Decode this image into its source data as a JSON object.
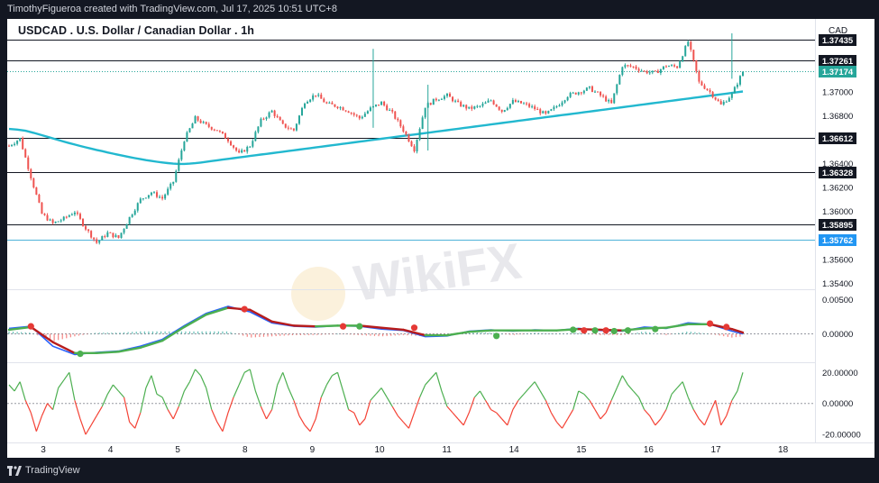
{
  "header": {
    "attribution": "TimothyFigueroa created with TradingView.com, Jul 17, 2025 10:51 UTC+8"
  },
  "chart": {
    "title": "USDCAD . U.S. Dollar / Canadian Dollar . 1h",
    "currency": "CAD",
    "watermark": "WikiFX"
  },
  "footer": {
    "brand": "TradingView"
  },
  "colors": {
    "background": "#131722",
    "panel": "#ffffff",
    "candle_up": "#26a69a",
    "candle_down": "#ef5350",
    "ma": "#22b8cf",
    "macd_line": "#2962ff",
    "signal_up": "#4caf50",
    "signal_down": "#b71c1c",
    "osc_up": "#4caf50",
    "osc_down": "#f44336"
  },
  "chart_data": [
    {
      "type": "candlestick",
      "name": "USDCAD 1h",
      "price_axis": {
        "ticks": [
          "1.37000",
          "1.36800",
          "1.36400",
          "1.36200",
          "1.36000",
          "1.35600",
          "1.35400"
        ],
        "ylim": [
          1.3535,
          1.3755
        ]
      },
      "x_axis": {
        "ticks": [
          "3",
          "4",
          "5",
          "8",
          "9",
          "10",
          "11",
          "14",
          "15",
          "16",
          "17",
          "18"
        ]
      },
      "horizontal_levels": [
        {
          "value": 1.37435,
          "label": "1.37435"
        },
        {
          "value": 1.37261,
          "label": "1.37261"
        },
        {
          "value": 1.36612,
          "label": "1.36612"
        },
        {
          "value": 1.36328,
          "label": "1.36328"
        },
        {
          "value": 1.35895,
          "label": "1.35895"
        },
        {
          "value": 1.35762,
          "label": "1.35762"
        }
      ],
      "last_price": {
        "value": 1.37174,
        "label": "1.37174"
      },
      "moving_average": {
        "x": [
          0,
          3,
          6,
          9,
          12,
          15,
          18,
          20,
          22,
          24,
          26,
          28,
          30,
          32,
          34,
          36,
          38,
          40,
          42,
          44,
          46,
          48,
          50,
          52,
          54,
          56,
          58,
          60,
          62,
          64,
          66,
          68,
          70,
          72,
          74,
          76,
          78,
          80,
          82,
          84,
          86,
          88,
          90,
          92,
          94,
          96,
          98,
          100,
          102,
          104,
          106,
          108,
          110,
          112,
          114,
          116,
          118,
          120,
          122,
          124,
          126,
          128,
          130,
          132,
          134,
          136,
          138,
          140,
          142,
          144,
          146,
          148,
          150,
          152,
          154,
          156,
          158,
          160,
          162,
          164,
          166,
          168,
          170,
          172,
          174,
          176,
          178,
          180,
          182,
          184,
          186,
          188,
          190,
          192,
          194,
          196,
          198,
          200,
          202,
          204,
          206,
          208,
          210,
          212,
          214,
          216,
          218,
          220,
          222,
          224,
          226,
          228,
          230,
          232,
          234,
          236,
          238,
          240,
          242,
          244,
          246,
          248,
          250,
          252,
          254,
          256,
          258,
          260,
          262,
          264,
          266,
          268
        ],
        "values": [
          1.3669,
          1.36685,
          1.36675,
          1.36658,
          1.36638,
          1.36618,
          1.36598,
          1.36585,
          1.36572,
          1.3656,
          1.36548,
          1.36537,
          1.36526,
          1.36515,
          1.36505,
          1.36494,
          1.36484,
          1.36474,
          1.36464,
          1.36455,
          1.36446,
          1.36438,
          1.3643,
          1.36423,
          1.36416,
          1.3641,
          1.36405,
          1.364,
          1.36398,
          1.36398,
          1.364,
          1.36404,
          1.36409,
          1.36415,
          1.36422,
          1.36428,
          1.36434,
          1.3644,
          1.36446,
          1.36452,
          1.36458,
          1.36464,
          1.3647,
          1.36476,
          1.36482,
          1.36488,
          1.36494,
          1.365,
          1.36506,
          1.36512,
          1.36518,
          1.36524,
          1.3653,
          1.36536,
          1.36542,
          1.36548,
          1.36554,
          1.3656,
          1.36566,
          1.36572,
          1.36578,
          1.36584,
          1.3659,
          1.36596,
          1.36602,
          1.36608,
          1.36614,
          1.3662,
          1.36626,
          1.36632,
          1.36638,
          1.36644,
          1.3665,
          1.36656,
          1.36662,
          1.36668,
          1.36674,
          1.3668,
          1.36686,
          1.36692,
          1.36698,
          1.36704,
          1.3671,
          1.36716,
          1.36722,
          1.36728,
          1.36734,
          1.3674,
          1.36746,
          1.36752,
          1.36758,
          1.36764,
          1.3677,
          1.36776,
          1.36782,
          1.36788,
          1.36794,
          1.368,
          1.36806,
          1.36812,
          1.36818,
          1.36824,
          1.3683,
          1.36836,
          1.36842,
          1.36848,
          1.36854,
          1.3686,
          1.36866,
          1.36872,
          1.36878,
          1.36884,
          1.3689,
          1.36896,
          1.36902,
          1.36908,
          1.36914,
          1.3692,
          1.36926,
          1.36932,
          1.36938,
          1.36944,
          1.3695,
          1.36956,
          1.36962,
          1.36968,
          1.36974,
          1.3698,
          1.36986,
          1.36992,
          1.36998,
          1.37004
        ]
      },
      "close_path": {
        "x": [
          0,
          4,
          8,
          12,
          16,
          20,
          24,
          28,
          32,
          36,
          40,
          44,
          48,
          52,
          56,
          60,
          64,
          68,
          72,
          76,
          80,
          84,
          88,
          92,
          96,
          100,
          104,
          108,
          112,
          116,
          120,
          124,
          128,
          132,
          136,
          140,
          144,
          148,
          152,
          156,
          160,
          164,
          168,
          172,
          176,
          180,
          184,
          188,
          192,
          196,
          200,
          204,
          208,
          212,
          216,
          220,
          224,
          228,
          232,
          236,
          240,
          244,
          248,
          252,
          256,
          260,
          264,
          268
        ],
        "values": [
          1.3655,
          1.3661,
          1.3629,
          1.3598,
          1.359,
          1.3594,
          1.36,
          1.3586,
          1.3574,
          1.3582,
          1.3578,
          1.3595,
          1.361,
          1.3616,
          1.3611,
          1.3625,
          1.366,
          1.3678,
          1.3672,
          1.3668,
          1.366,
          1.3648,
          1.3655,
          1.3676,
          1.3684,
          1.3672,
          1.3668,
          1.3692,
          1.3698,
          1.369,
          1.3688,
          1.3684,
          1.3678,
          1.3686,
          1.3691,
          1.3682,
          1.3668,
          1.3652,
          1.3688,
          1.3694,
          1.3697,
          1.369,
          1.3686,
          1.3688,
          1.3693,
          1.3684,
          1.3692,
          1.369,
          1.3686,
          1.3681,
          1.3688,
          1.3697,
          1.37,
          1.3703,
          1.3697,
          1.369,
          1.3722,
          1.3721,
          1.3717,
          1.3716,
          1.3722,
          1.3721,
          1.3742,
          1.3708,
          1.37,
          1.3689,
          1.3698,
          1.3717
        ]
      }
    },
    {
      "type": "line",
      "name": "MACD",
      "y_ticks": [
        "0.00500",
        "0.00000"
      ],
      "ylim": [
        -0.004,
        0.0065
      ],
      "x": [
        0,
        8,
        16,
        24,
        32,
        40,
        48,
        56,
        64,
        72,
        80,
        88,
        96,
        104,
        112,
        120,
        128,
        136,
        144,
        152,
        160,
        168,
        176,
        184,
        192,
        200,
        208,
        216,
        224,
        232,
        240,
        248,
        256,
        264,
        268
      ],
      "macd": [
        0.0008,
        0.0011,
        -0.0018,
        -0.003,
        -0.0027,
        -0.0025,
        -0.0018,
        -0.0008,
        0.0012,
        0.003,
        0.004,
        0.0032,
        0.0016,
        0.0011,
        0.001,
        0.0012,
        0.0011,
        0.0007,
        0.0005,
        -0.0004,
        -0.0003,
        0.0004,
        0.0006,
        0.0004,
        0.0006,
        0.0005,
        0.0008,
        0.0005,
        0.0004,
        0.001,
        0.0008,
        0.0016,
        0.0014,
        0.0004,
        0.0
      ],
      "signal": [
        0.0006,
        0.001,
        -0.0012,
        -0.0028,
        -0.0028,
        -0.0026,
        -0.002,
        -0.001,
        0.001,
        0.0028,
        0.0038,
        0.0035,
        0.0018,
        0.0012,
        0.0011,
        0.0012,
        0.0012,
        0.0009,
        0.0006,
        -0.0002,
        -0.0002,
        0.0003,
        0.0005,
        0.0005,
        0.0005,
        0.0005,
        0.0007,
        0.0006,
        0.0005,
        0.0008,
        0.0009,
        0.0014,
        0.0014,
        0.0007,
        0.0002
      ],
      "crosses": [
        {
          "x": 8,
          "value": 0.0011,
          "dir": "down"
        },
        {
          "x": 26,
          "value": -0.0029,
          "dir": "up"
        },
        {
          "x": 86,
          "value": 0.0036,
          "dir": "down"
        },
        {
          "x": 122,
          "value": 0.0011,
          "dir": "down"
        },
        {
          "x": 128,
          "value": 0.0011,
          "dir": "up"
        },
        {
          "x": 148,
          "value": 0.0009,
          "dir": "down"
        },
        {
          "x": 178,
          "value": -0.0003,
          "dir": "up"
        },
        {
          "x": 206,
          "value": 0.0006,
          "dir": "up"
        },
        {
          "x": 210,
          "value": 0.0005,
          "dir": "down"
        },
        {
          "x": 214,
          "value": 0.0005,
          "dir": "up"
        },
        {
          "x": 218,
          "value": 0.0005,
          "dir": "down"
        },
        {
          "x": 221,
          "value": 0.0004,
          "dir": "up"
        },
        {
          "x": 226,
          "value": 0.0005,
          "dir": "up"
        },
        {
          "x": 236,
          "value": 0.0007,
          "dir": "up"
        },
        {
          "x": 256,
          "value": 0.0015,
          "dir": "down"
        },
        {
          "x": 262,
          "value": 0.001,
          "dir": "down"
        }
      ]
    },
    {
      "type": "line",
      "name": "Oscillator",
      "y_ticks": [
        "20.00000",
        "0.00000",
        "-20.00000"
      ],
      "ylim": [
        -24,
        26
      ],
      "x": [
        0,
        2,
        4,
        6,
        8,
        10,
        12,
        14,
        16,
        18,
        20,
        22,
        24,
        26,
        28,
        30,
        32,
        34,
        36,
        38,
        40,
        42,
        44,
        46,
        48,
        50,
        52,
        54,
        56,
        58,
        60,
        62,
        64,
        66,
        68,
        70,
        72,
        74,
        76,
        78,
        80,
        82,
        84,
        86,
        88,
        90,
        92,
        94,
        96,
        98,
        100,
        102,
        104,
        106,
        108,
        110,
        112,
        114,
        116,
        118,
        120,
        122,
        124,
        126,
        128,
        130,
        132,
        134,
        136,
        138,
        140,
        142,
        144,
        146,
        148,
        150,
        152,
        154,
        156,
        158,
        160,
        162,
        164,
        166,
        168,
        170,
        172,
        174,
        176,
        178,
        180,
        182,
        184,
        186,
        188,
        190,
        192,
        194,
        196,
        198,
        200,
        202,
        204,
        206,
        208,
        210,
        212,
        214,
        216,
        218,
        220,
        222,
        224,
        226,
        228,
        230,
        232,
        234,
        236,
        238,
        240,
        242,
        244,
        246,
        248,
        250,
        252,
        254,
        256,
        258,
        260,
        262,
        264,
        266,
        268
      ],
      "values": [
        12,
        8,
        14,
        2,
        -6,
        -18,
        -8,
        0,
        -4,
        10,
        15,
        20,
        2,
        -10,
        -20,
        -14,
        -8,
        -2,
        6,
        12,
        8,
        4,
        -12,
        -16,
        -6,
        10,
        18,
        6,
        4,
        -4,
        -10,
        -2,
        8,
        14,
        22,
        18,
        10,
        -4,
        -12,
        -18,
        -6,
        4,
        12,
        20,
        22,
        8,
        -2,
        -10,
        -4,
        12,
        20,
        10,
        2,
        -8,
        -14,
        -18,
        -10,
        4,
        12,
        18,
        20,
        8,
        -4,
        -6,
        -14,
        -10,
        2,
        6,
        10,
        4,
        -2,
        -8,
        -12,
        -16,
        -6,
        4,
        12,
        16,
        20,
        8,
        -2,
        -6,
        -10,
        -14,
        -6,
        4,
        8,
        2,
        -4,
        -6,
        -10,
        -14,
        -4,
        2,
        6,
        10,
        14,
        8,
        2,
        -6,
        -12,
        -16,
        -10,
        -4,
        8,
        6,
        2,
        -4,
        -10,
        -6,
        2,
        10,
        18,
        12,
        8,
        4,
        -4,
        -8,
        -14,
        -10,
        -4,
        6,
        10,
        14,
        4,
        -4,
        -10,
        -14,
        -6,
        2,
        -14,
        -8,
        2,
        8,
        20
      ]
    }
  ]
}
